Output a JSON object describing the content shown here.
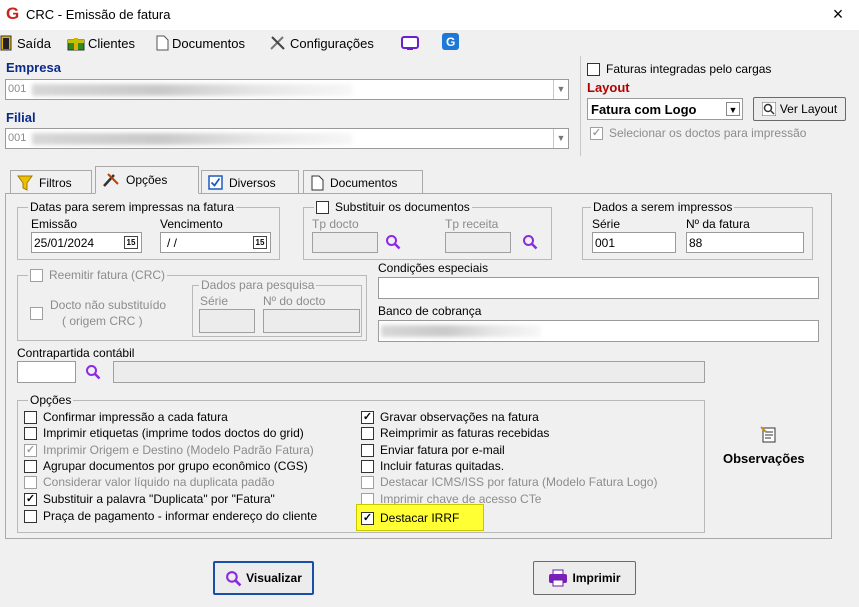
{
  "window": {
    "title": "CRC - Emissão de fatura",
    "close": "×",
    "logo": "G"
  },
  "toolbar": {
    "saida": "Saída",
    "clientes": "Clientes",
    "documentos": "Documentos",
    "configuracoes": "Configurações"
  },
  "empresa": {
    "label": "Empresa",
    "value": "001"
  },
  "filial": {
    "label": "Filial",
    "value": "001"
  },
  "faturas_integradas": "Faturas integradas pelo cargas",
  "layout": {
    "label": "Layout",
    "value": "Fatura com Logo",
    "ver_layout": "Ver Layout"
  },
  "selecionar_doctos": "Selecionar os doctos para impressão",
  "tabs": [
    {
      "label": "Filtros"
    },
    {
      "label": "Opções"
    },
    {
      "label": "Diversos"
    },
    {
      "label": "Documentos"
    }
  ],
  "datas": {
    "legend": "Datas para serem impressas na fatura",
    "emissao_label": "Emissão",
    "emissao_value": "25/01/2024",
    "vencimento_label": "Vencimento",
    "vencimento_value": " / /",
    "cal_icon": "15"
  },
  "substituir": {
    "legend": "Substituir os documentos",
    "tp_docto": "Tp docto",
    "tp_receita": "Tp receita"
  },
  "dados_impressos": {
    "legend": "Dados a serem impressos",
    "serie_label": "Série",
    "serie_value": "001",
    "nfatura_label": "Nº da fatura",
    "nfatura_value": "88"
  },
  "reemitir": {
    "label": "Reemitir fatura (CRC)",
    "docto_nao_subst_1": "Docto não substituído",
    "docto_nao_subst_2": "( origem CRC )",
    "dados_pesquisa": "Dados para pesquisa",
    "serie": "Série",
    "n_docto": "Nº do docto"
  },
  "condicoes": "Condições especiais",
  "banco": "Banco de cobrança",
  "contrapartida": "Contrapartida contábil",
  "opcoes": {
    "legend": "Opções",
    "left": [
      {
        "label": "Confirmar impressão a cada fatura",
        "checked": false,
        "disabled": false
      },
      {
        "label": "Imprimir etiquetas (imprime todos doctos do grid)",
        "checked": false,
        "disabled": false
      },
      {
        "label": "Imprimir Origem e Destino (Modelo Padrão Fatura)",
        "checked": true,
        "disabled": true
      },
      {
        "label": "Agrupar documentos por grupo econômico (CGS)",
        "checked": false,
        "disabled": false
      },
      {
        "label": "Considerar valor líquido na duplicata padão",
        "checked": false,
        "disabled": true
      },
      {
        "label": "Substituir a palavra \"Duplicata\" por \"Fatura\"",
        "checked": true,
        "disabled": false
      },
      {
        "label": "Praça de pagamento - informar endereço do cliente",
        "checked": false,
        "disabled": false
      }
    ],
    "right": [
      {
        "label": "Gravar observações na fatura",
        "checked": true,
        "disabled": false
      },
      {
        "label": "Reimprimir as faturas recebidas",
        "checked": false,
        "disabled": false
      },
      {
        "label": "Enviar fatura por e-mail",
        "checked": false,
        "disabled": false
      },
      {
        "label": "Incluir faturas quitadas.",
        "checked": false,
        "disabled": false
      },
      {
        "label": "Destacar ICMS/ISS por fatura (Modelo Fatura Logo)",
        "checked": false,
        "disabled": true
      },
      {
        "label": "Imprimir chave de acesso CTe",
        "checked": false,
        "disabled": true
      },
      {
        "label": "Destacar IRRF",
        "checked": true,
        "disabled": false,
        "highlight": "#ffff33"
      }
    ]
  },
  "observacoes": "Observações",
  "buttons": {
    "visualizar": "Visualizar",
    "imprimir": "Imprimir"
  },
  "check_mark": "✓",
  "icons": [
    "g-logo-icon",
    "door-icon",
    "gift-icon",
    "document-icon",
    "tools-icon",
    "monitor-icon",
    "g-app-icon",
    "filter-icon",
    "options-icon",
    "checkbox-icon",
    "page-icon",
    "search-icon",
    "calendar-icon",
    "observacoes-icon",
    "printer-icon"
  ]
}
